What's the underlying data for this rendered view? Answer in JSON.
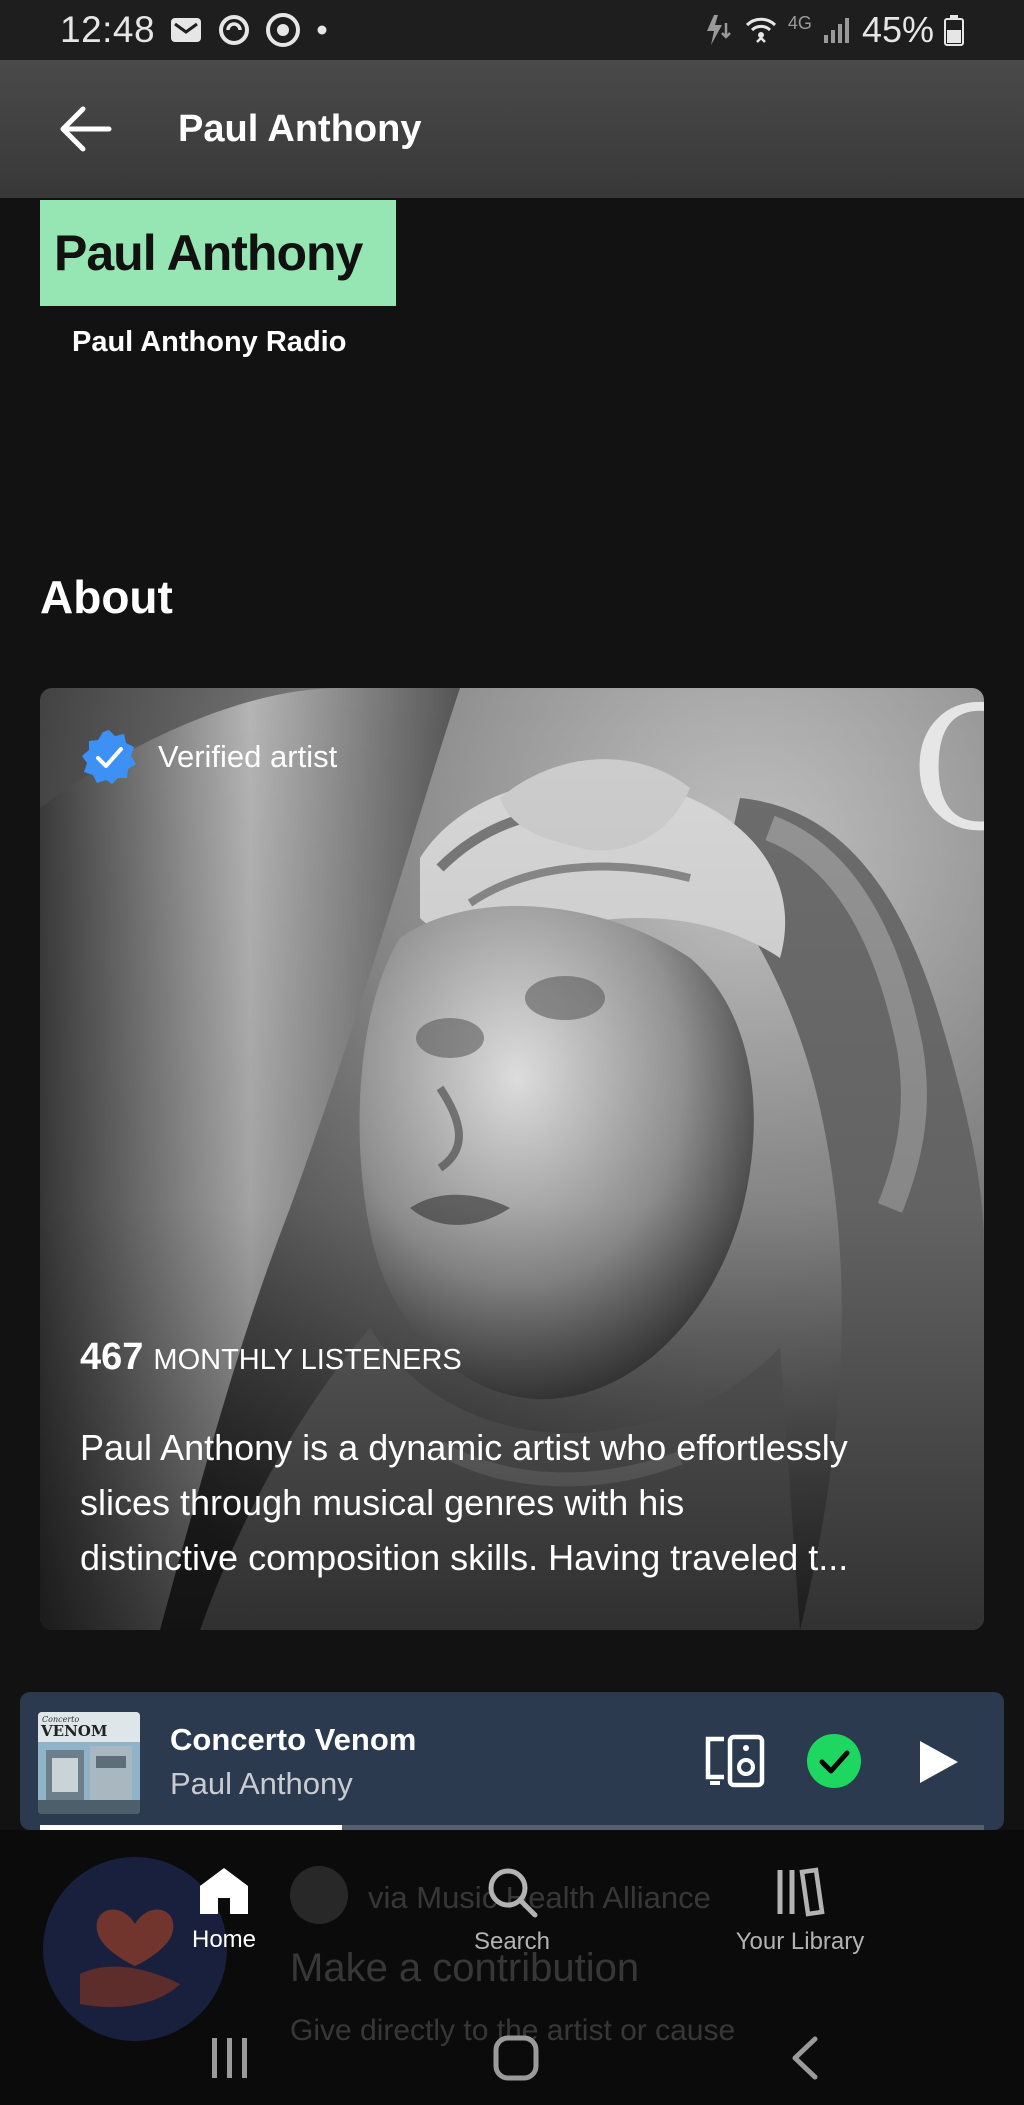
{
  "status_bar": {
    "time": "12:48",
    "network": "4G",
    "battery": "45%"
  },
  "header": {
    "title": "Paul Anthony"
  },
  "radio": {
    "card_title": "Paul Anthony",
    "label": "Paul Anthony Radio"
  },
  "about": {
    "heading": "About",
    "verified_label": "Verified artist",
    "listeners_count": "467",
    "listeners_label": "MONTHLY LISTENERS",
    "bio_lines": [
      "Paul Anthony is a dynamic artist who effortlessly",
      "slices through musical genres with his",
      "distinctive composition skills. Having traveled t..."
    ],
    "watermark": "O"
  },
  "mini_player": {
    "title": "Concerto Venom",
    "artist": "Paul Anthony",
    "art_text": "VENOM",
    "art_script": "Concerto",
    "progress": 0.32
  },
  "ghost_content": {
    "via": "via Music Health Alliance",
    "contribution": "Make a contribution",
    "give": "Give directly to the artist or cause"
  },
  "nav": {
    "home": "Home",
    "search": "Search",
    "library": "Your Library",
    "active": "home"
  },
  "colors": {
    "accent_green": "#1ed760",
    "radio_card": "#95e6b3",
    "player_bg": "#2b3a4e",
    "verified_blue": "#3d91f4"
  }
}
